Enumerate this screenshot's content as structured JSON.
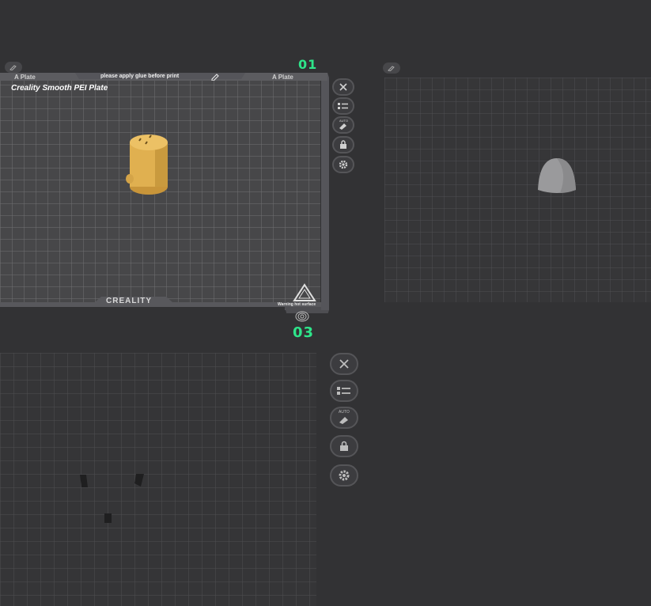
{
  "plates": {
    "plate1": {
      "label": "01",
      "title": "Creality Smooth PEI Plate",
      "header_notice": "please apply glue before print",
      "tab_left": "A Plate",
      "tab_right": "A Plate",
      "brand": "CREALITY",
      "warning": "Warning hot surface"
    },
    "plate3": {
      "label": "03"
    }
  },
  "toolbar": {
    "auto_label": "AUTO"
  },
  "colors": {
    "background": "#323234",
    "plate_bg": "#434345",
    "grid_line": "#6a6a6c",
    "model_gold": "#e0b050",
    "accent_green": "#2ee58a"
  },
  "icons": [
    "close-icon",
    "list-icon",
    "auto-arrange-icon",
    "lock-icon",
    "gear-icon",
    "edit-icon",
    "warning-triangle-icon",
    "fingerprint-logo-icon"
  ]
}
